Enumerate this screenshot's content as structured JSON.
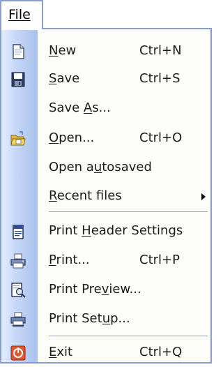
{
  "menubar": {
    "file_label": "File"
  },
  "menu": {
    "items": [
      {
        "key": "new",
        "pre": "",
        "accel": "N",
        "post": "ew",
        "shortcut": "Ctrl+N",
        "icon": "new-document-icon"
      },
      {
        "key": "save",
        "pre": "",
        "accel": "S",
        "post": "ave",
        "shortcut": "Ctrl+S",
        "icon": "floppy-disk-icon"
      },
      {
        "key": "save-as",
        "pre": "Save ",
        "accel": "A",
        "post": "s...",
        "shortcut": "",
        "icon": ""
      },
      {
        "key": "open",
        "pre": "",
        "accel": "O",
        "post": "pen...",
        "shortcut": "Ctrl+O",
        "icon": "open-folder-icon"
      },
      {
        "key": "open-autosaved",
        "pre": "Open a",
        "accel": "u",
        "post": "tosaved",
        "shortcut": "",
        "icon": ""
      },
      {
        "key": "recent-files",
        "pre": "",
        "accel": "R",
        "post": "ecent files",
        "shortcut": "",
        "icon": "",
        "submenu": true
      },
      {
        "key": "print-header-settings",
        "pre": "Print ",
        "accel": "H",
        "post": "eader Settings",
        "shortcut": "",
        "icon": "print-header-icon"
      },
      {
        "key": "print",
        "pre": "",
        "accel": "P",
        "post": "rint...",
        "shortcut": "Ctrl+P",
        "icon": "printer-icon"
      },
      {
        "key": "print-preview",
        "pre": "Print Pre",
        "accel": "v",
        "post": "iew...",
        "shortcut": "",
        "icon": "print-preview-icon"
      },
      {
        "key": "print-setup",
        "pre": "Print Set",
        "accel": "u",
        "post": "p...",
        "shortcut": "",
        "icon": "print-setup-icon"
      },
      {
        "key": "exit",
        "pre": "",
        "accel": "E",
        "post": "xit",
        "shortcut": "Ctrl+Q",
        "icon": "exit-icon"
      }
    ]
  }
}
